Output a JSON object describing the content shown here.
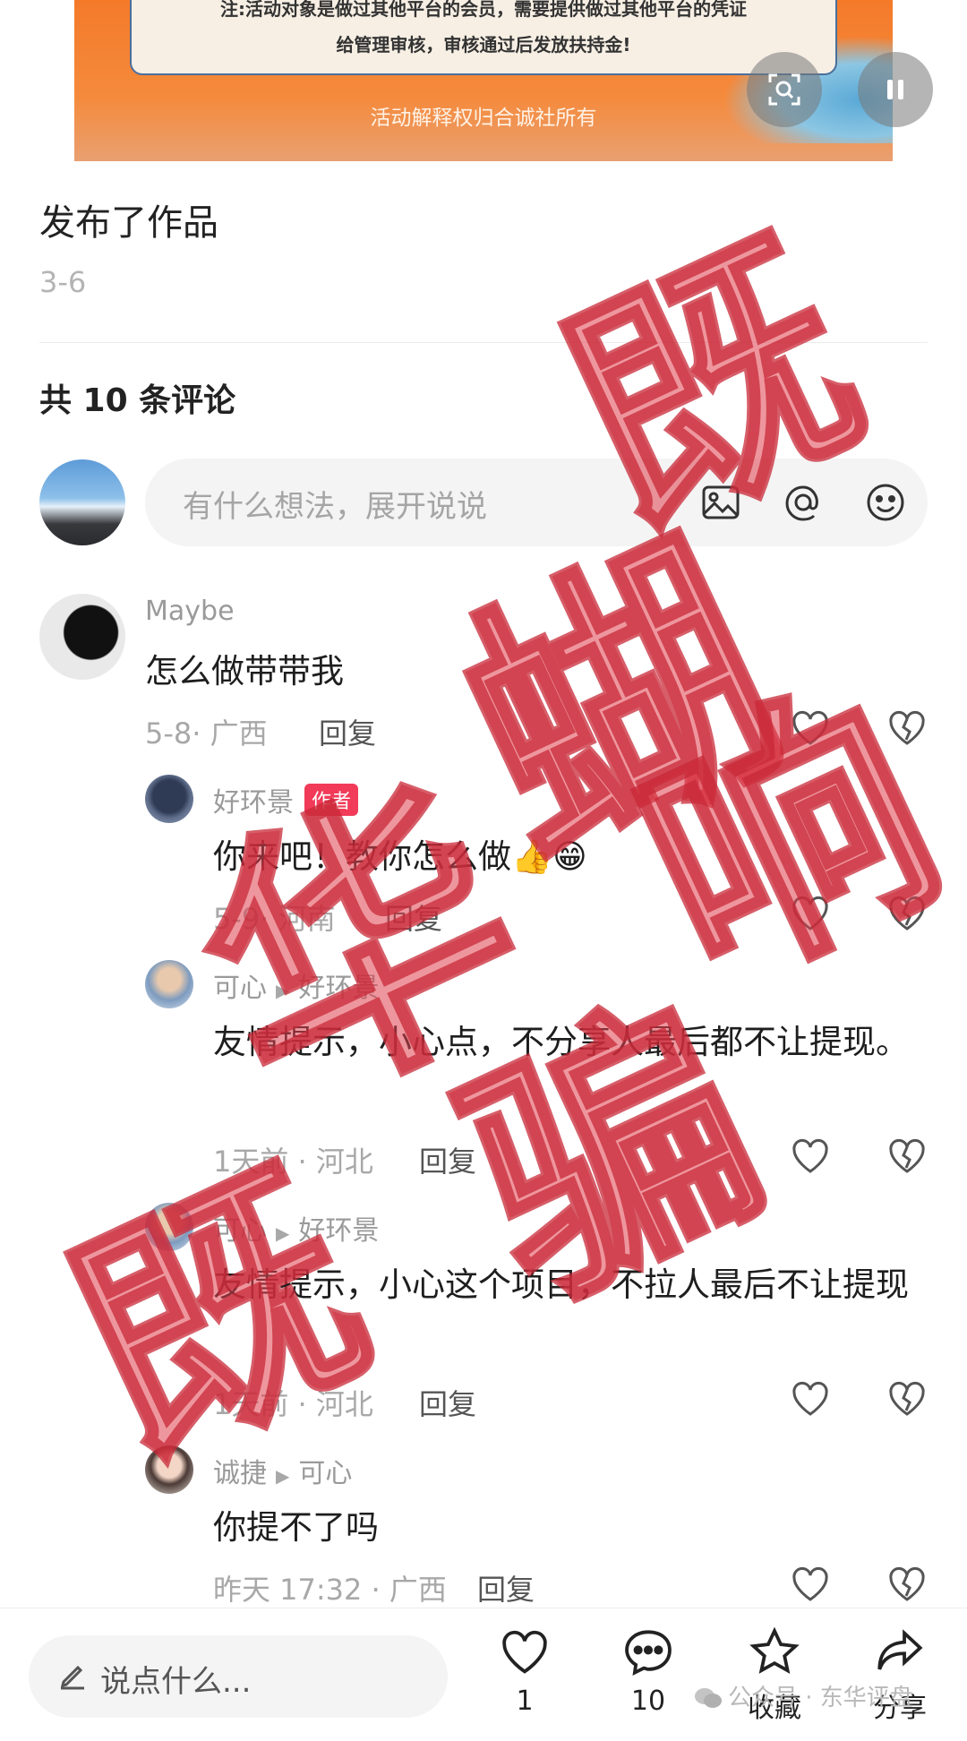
{
  "banner": {
    "notice_line1": "注:活动对象是做过其他平台的会员，需要提供做过其他平台的凭证",
    "notice_line2": "给管理审核，审核通过后发放扶持金!",
    "footer": "活动解释权归合诚社所有"
  },
  "post": {
    "action": "发布了作品",
    "date": "3-6"
  },
  "comments_header": "共 10 条评论",
  "comment_input": {
    "placeholder": "有什么想法，展开说说"
  },
  "comments": [
    {
      "user": "Maybe",
      "text": "怎么做带带我",
      "time_loc": "5-8· 广西",
      "reply": "回复"
    },
    {
      "user": "好环景",
      "badge": "作者",
      "text": "你来吧！教你怎么做👍😁",
      "time_loc": "5-9· 河南",
      "reply": "回复"
    },
    {
      "user": "可心",
      "reply_to": "好环景",
      "text": "友情提示，小心点，不分享人最后都不让提现。",
      "time_loc": "1天前 · 河北",
      "reply": "回复"
    },
    {
      "user": "可心",
      "reply_to": "好环景",
      "text": "友情提示，小心这个项目，不拉人最后不让提现",
      "time_loc": "1天前 · 河北",
      "reply": "回复"
    },
    {
      "user": "诚捷",
      "reply_to": "可心",
      "text": "你提不了吗",
      "time_loc": "昨天 17:32 · 广西",
      "reply": "回复"
    }
  ],
  "bottom_bar": {
    "say_placeholder": "说点什么...",
    "like_count": "1",
    "comment_count": "10",
    "collect_label": "收藏",
    "share_label": "分享"
  },
  "watermark": {
    "wechat": "公众号 · 东华评盘",
    "stamp_chars": [
      "既",
      "蝴",
      "华",
      "响",
      "骗",
      "既"
    ]
  },
  "colors": {
    "accent": "#f13b59",
    "stamp": "#e0404f"
  },
  "icons": [
    "scan-icon",
    "pause-icon",
    "image-icon",
    "at-icon",
    "emoji-icon",
    "heart-icon",
    "broken-heart-icon",
    "pencil-icon",
    "comment-icon",
    "star-icon",
    "share-icon",
    "wechat-icon"
  ]
}
